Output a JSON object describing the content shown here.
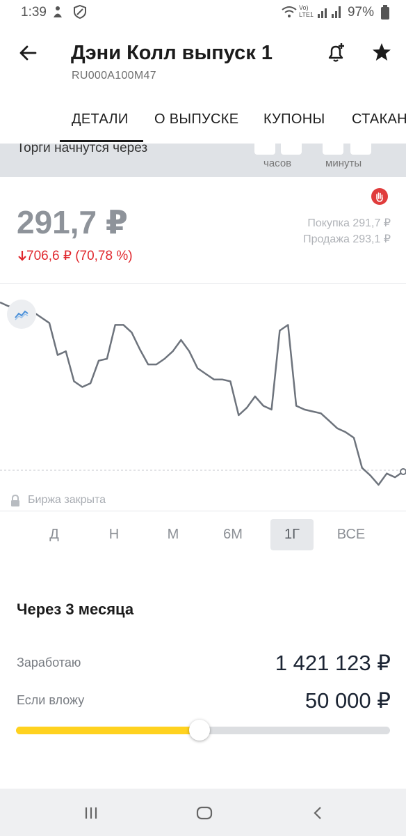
{
  "status_bar": {
    "time": "1:39",
    "battery": "97%",
    "network_label": "Vo) LTE1"
  },
  "header": {
    "title": "Дэни Колл выпуск 1",
    "isin": "RU000A100M47"
  },
  "tabs": [
    "ДЕТАЛИ",
    "О ВЫПУСКЕ",
    "КУПОНЫ",
    "СТАКАН"
  ],
  "countdown": {
    "text": "Торги начнутся через",
    "hours_label": "часов",
    "minutes_label": "минуты"
  },
  "price": {
    "current": "291,7 ₽",
    "change": "706,6 ₽ (70,78 %)",
    "buy": "Покупка  291,7  ₽",
    "sell": "Продажа  293,1  ₽"
  },
  "chart_data": {
    "type": "line",
    "series": [
      {
        "values": [
          0.0,
          0.02,
          0.03,
          0.03,
          0.05,
          0.08,
          0.11,
          0.28,
          0.26,
          0.42,
          0.45,
          0.43,
          0.31,
          0.3,
          0.12,
          0.12,
          0.16,
          0.25,
          0.33,
          0.33,
          0.3,
          0.26,
          0.2,
          0.26,
          0.35,
          0.38,
          0.41,
          0.41,
          0.42,
          0.6,
          0.56,
          0.5,
          0.55,
          0.57,
          0.15,
          0.12,
          0.55,
          0.57,
          0.58,
          0.59,
          0.63,
          0.67,
          0.69,
          0.72,
          0.88,
          0.92,
          0.97,
          0.91,
          0.93,
          0.9
        ]
      }
    ],
    "accent_color": "#6d737c",
    "baseline": "dotted"
  },
  "chart": {
    "closed_label": "Биржа закрыта"
  },
  "periods": {
    "items": [
      "Д",
      "Н",
      "М",
      "6М",
      "1Г",
      "ВСЕ"
    ],
    "active": "1Г"
  },
  "calculator": {
    "title": "Через 3 месяца",
    "earn_label": "Заработаю",
    "earn_value": "1 421 123 ₽",
    "invest_label": "Если вложу",
    "invest_value": "50 000 ₽",
    "slider_fraction": 0.49
  },
  "colors": {
    "accent_yellow": "#ffd21f",
    "negative_red": "#e0282e",
    "halt_red": "#e03c3c"
  }
}
